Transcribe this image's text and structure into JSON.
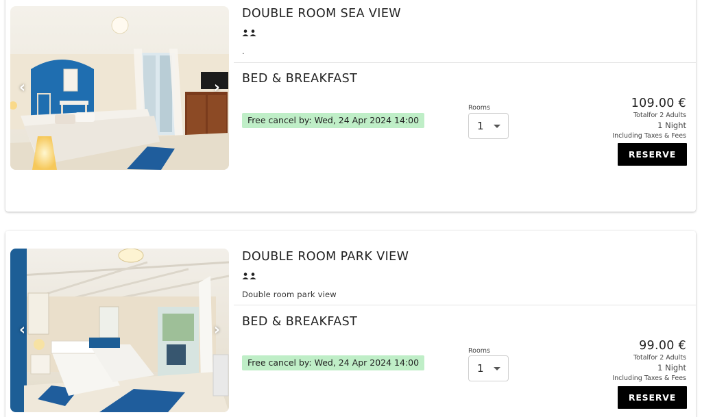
{
  "rooms": [
    {
      "title": "DOUBLE ROOM SEA VIEW",
      "description": ".",
      "board": "BED & BREAKFAST",
      "cancel_text": "Free cancel by: Wed, 24 Apr 2024 14:00",
      "rooms_label": "Rooms",
      "rooms_value": "1",
      "price": "109.00 €",
      "total_for": "Totalfor 2 Adults",
      "nights": "1 Night",
      "taxes": "Including Taxes & Fees",
      "reserve_label": "RESERVE"
    },
    {
      "title": "DOUBLE ROOM PARK VIEW",
      "description": "Double room park view",
      "board": "BED & BREAKFAST",
      "cancel_text": "Free cancel by: Wed, 24 Apr 2024 14:00",
      "rooms_label": "Rooms",
      "rooms_value": "1",
      "price": "99.00 €",
      "total_for": "Totalfor 2 Adults",
      "nights": "1 Night",
      "taxes": "Including Taxes & Fees",
      "reserve_label": "RESERVE"
    }
  ],
  "icons": {
    "prev": "chevron-left-icon",
    "next": "chevron-right-icon",
    "guests": "two-persons-icon",
    "dropdown": "caret-down-icon"
  },
  "colors": {
    "cancel_badge_bg": "#bfeec7",
    "reserve_bg": "#000000",
    "wall_blue": "#1f6eb0"
  }
}
